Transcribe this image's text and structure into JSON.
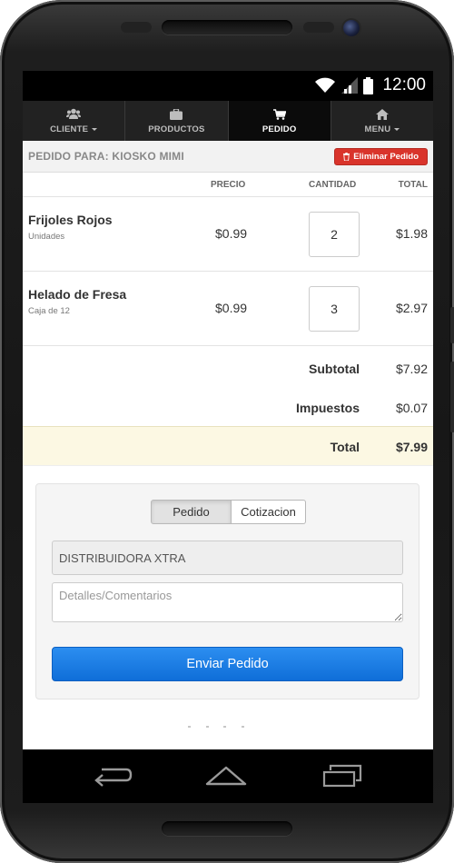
{
  "statusbar": {
    "time": "12:00"
  },
  "navbar": {
    "items": [
      {
        "label": "CLIENTE",
        "icon": "users-icon",
        "has_caret": true
      },
      {
        "label": "PRODUCTOS",
        "icon": "briefcase-icon",
        "has_caret": false
      },
      {
        "label": "PEDIDO",
        "icon": "cart-icon",
        "has_caret": false,
        "active": true
      },
      {
        "label": "MENU",
        "icon": "home-icon",
        "has_caret": true
      }
    ]
  },
  "order": {
    "title": "PEDIDO PARA: KIOSKO MIMI",
    "delete_label": "Eliminar Pedido",
    "columns": {
      "price": "PRECIO",
      "quantity": "CANTIDAD",
      "total": "TOTAL"
    },
    "items": [
      {
        "name": "Frijoles Rojos",
        "unit": "Unidades",
        "price": "$0.99",
        "quantity": "2",
        "total": "$1.98"
      },
      {
        "name": "Helado de Fresa",
        "unit": "Caja de 12",
        "price": "$0.99",
        "quantity": "3",
        "total": "$2.97"
      }
    ],
    "subtotal_label": "Subtotal",
    "subtotal": "$7.92",
    "tax_label": "Impuestos",
    "tax": "$0.07",
    "total_label": "Total",
    "total": "$7.99"
  },
  "form": {
    "type_options": [
      "Pedido",
      "Cotizacion"
    ],
    "selected_type": "Pedido",
    "distributor": "DISTRIBUIDORA XTRA",
    "comments_placeholder": "Detalles/Comentarios",
    "submit_label": "Enviar Pedido"
  },
  "colors": {
    "navbar": "#222222",
    "delete_button": "#d9342b",
    "total_row": "#fcf8e3",
    "primary_button": "#1a7ae0"
  }
}
